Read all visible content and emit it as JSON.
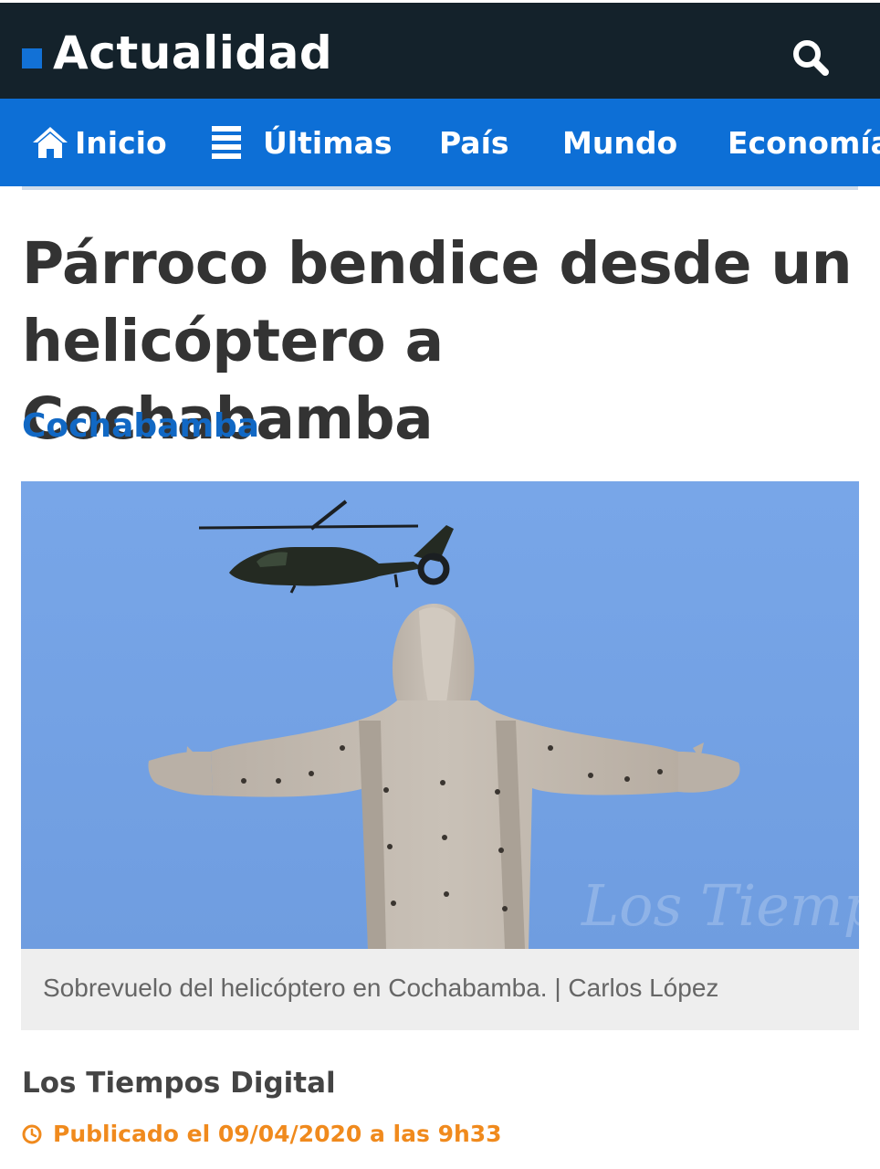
{
  "header": {
    "title": "Actualidad",
    "search_icon": "search-icon",
    "accent_color": "#1271d6",
    "background_color": "#14222b"
  },
  "nav": {
    "background_color": "#0d6fd6",
    "items": [
      {
        "label": "Inicio",
        "icon": "home-icon"
      },
      {
        "label": "Últimas",
        "icon": "list-icon"
      },
      {
        "label": "País"
      },
      {
        "label": "Mundo"
      },
      {
        "label": "Economía"
      }
    ]
  },
  "article": {
    "headline": "Párroco bendice desde un helicóptero a Cochabamba",
    "section": "Cochabamba",
    "image": {
      "watermark": "Los Tiempos",
      "caption": "Sobrevuelo del helicóptero en Cochabamba. | Carlos López"
    },
    "author": "Los Tiempos Digital",
    "published": "Publicado el 09/04/2020 a las 9h33",
    "published_color": "#f08a1d",
    "section_color": "#1168c4"
  }
}
